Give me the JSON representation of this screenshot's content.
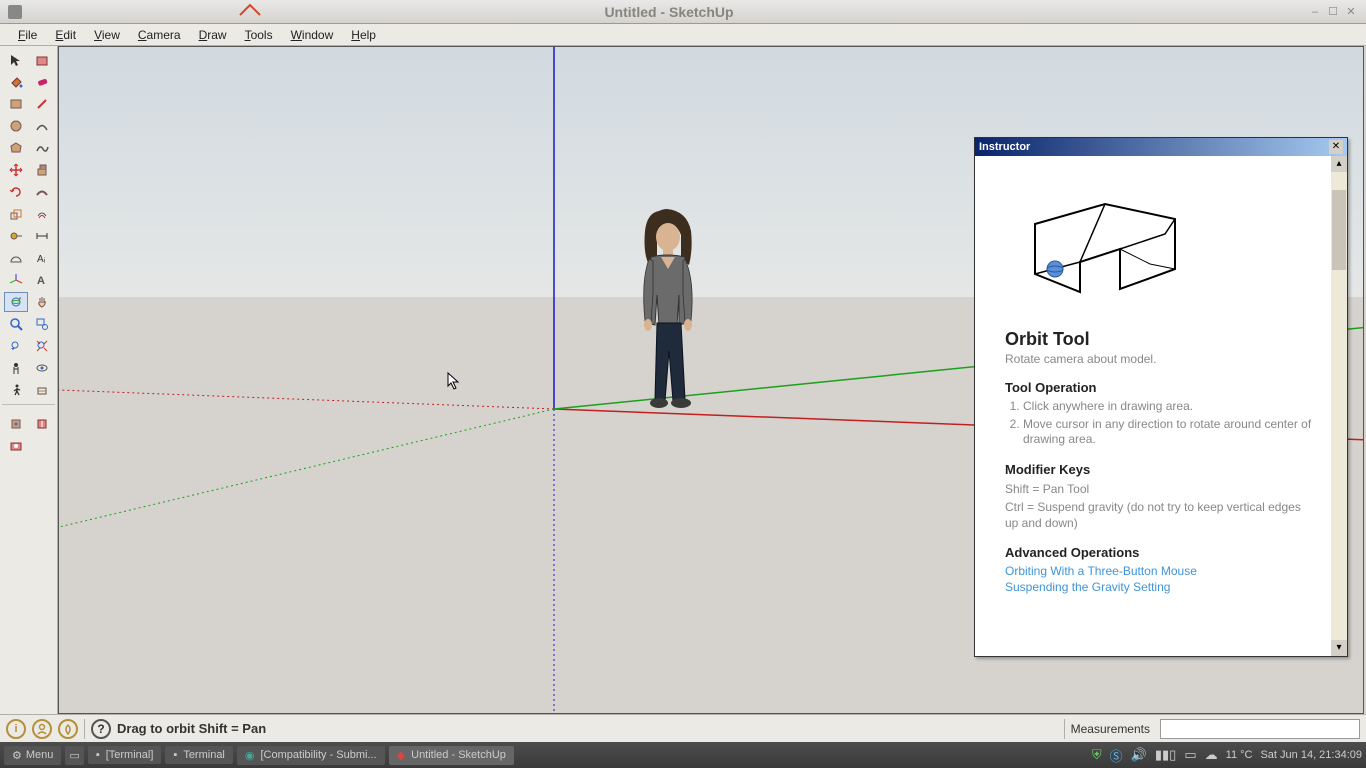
{
  "window": {
    "title": "Untitled - SketchUp",
    "minimize": "–",
    "maximize": "☐",
    "close": "✕"
  },
  "menus": {
    "items": [
      "File",
      "Edit",
      "View",
      "Camera",
      "Draw",
      "Tools",
      "Window",
      "Help"
    ]
  },
  "tools": {
    "items": [
      [
        "select-icon",
        "component-icon"
      ],
      [
        "paint-bucket-icon",
        "eraser-icon"
      ],
      [
        "rectangle-icon",
        "line-icon"
      ],
      [
        "circle-icon",
        "arc-icon"
      ],
      [
        "polygon-icon",
        "freehand-icon"
      ],
      [
        "move-icon",
        "pushpull-icon"
      ],
      [
        "rotate-icon",
        "followme-icon"
      ],
      [
        "scale-icon",
        "offset-icon"
      ],
      [
        "tape-icon",
        "dimension-icon"
      ],
      [
        "protractor-icon",
        "text-icon"
      ],
      [
        "axes-icon",
        "3dtext-icon"
      ],
      [
        "orbit-icon",
        "pan-icon"
      ],
      [
        "zoom-icon",
        "zoomwindow-icon"
      ],
      [
        "previous-icon",
        "zoomextents-icon"
      ],
      [
        "position-camera-icon",
        "lookaround-icon"
      ],
      [
        "walk-icon",
        "section-icon"
      ]
    ],
    "sep": "",
    "extra": [
      [
        "getmodels-icon",
        "sharemodel-icon"
      ],
      [
        "getphoto-icon",
        ""
      ]
    ]
  },
  "instructor": {
    "panel_title": "Instructor",
    "close": "✕",
    "title": "Orbit Tool",
    "subtitle": "Rotate camera about model.",
    "section1": "Tool Operation",
    "ops": [
      "Click anywhere in drawing area.",
      "Move cursor in any direction to rotate around center of drawing area."
    ],
    "section2": "Modifier Keys",
    "mods": [
      "Shift = Pan Tool",
      "Ctrl = Suspend gravity (do not try to keep vertical edges up and down)"
    ],
    "section3": "Advanced Operations",
    "links": [
      "Orbiting With a Three-Button Mouse",
      "Suspending the Gravity Setting"
    ]
  },
  "status": {
    "hint": "Drag to orbit   Shift = Pan",
    "measure_label": "Measurements"
  },
  "taskbar": {
    "menu": "Menu",
    "items": [
      "[Terminal]",
      "Terminal",
      "[Compatibility - Submi...",
      "Untitled - SketchUp"
    ],
    "temp": "11 °C",
    "clock": "Sat Jun 14, 21:34:09"
  }
}
